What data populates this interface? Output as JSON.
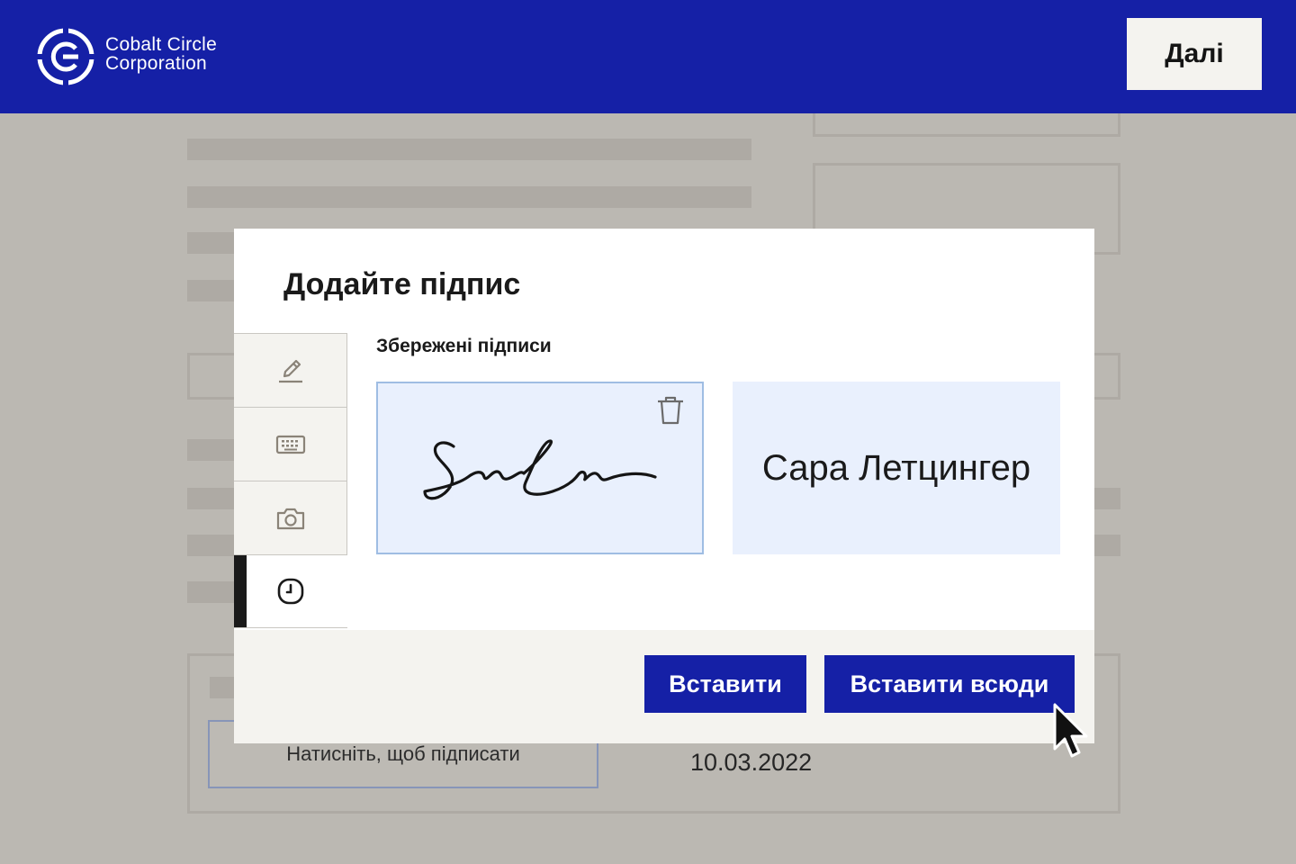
{
  "header": {
    "brand_line1": "Cobalt Circle",
    "brand_line2": "Corporation",
    "next_label": "Далі",
    "color": "#1520a6"
  },
  "document": {
    "sign_field_label": "Натисніть, щоб підписати",
    "date": "10.03.2022"
  },
  "modal": {
    "title": "Додайте підпис",
    "tabs": [
      {
        "icon": "pencil-icon"
      },
      {
        "icon": "keyboard-icon"
      },
      {
        "icon": "camera-icon"
      },
      {
        "icon": "clock-icon",
        "active": true
      }
    ],
    "saved_title": "Збережені підписи",
    "saved_signatures": [
      {
        "kind": "drawn",
        "selected": true,
        "icon": "trash-icon"
      },
      {
        "kind": "typed",
        "text": "Сара Летцингер"
      }
    ],
    "buttons": {
      "insert": "Вставити",
      "insert_all": "Вставити всюди"
    }
  }
}
